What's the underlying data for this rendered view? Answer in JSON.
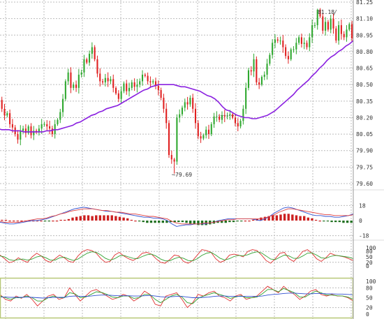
{
  "colors": {
    "background": "#ffffff",
    "grid": "#bcbcbc",
    "up": "#2fa82f",
    "down": "#e02020",
    "ma": "#8a20e0",
    "macd_signal_red": "#e04040",
    "macd_line_blue": "#3050d0",
    "hist_pos": "#cc2020",
    "hist_neg": "#207020",
    "stoch_red": "#e03030",
    "stoch_green": "#30a030",
    "stoch_blue": "#3050d0",
    "panel_frame": "#b8c878"
  },
  "chart_data": [
    {
      "type": "candlestick",
      "title": "",
      "y_ticks": [
        "81.25",
        "81.10",
        "80.95",
        "80.80",
        "80.65",
        "80.50",
        "80.35",
        "80.20",
        "80.05",
        "79.90",
        "79.75",
        "79.60"
      ],
      "ylim": [
        79.6,
        81.25
      ],
      "grid": true,
      "annotations": [
        {
          "text": "79.69",
          "value": 79.69
        },
        {
          "text": "81.18",
          "value": 81.18
        }
      ],
      "series": [
        {
          "kind": "candles",
          "close": [
            80.36,
            80.28,
            80.22,
            80.24,
            80.14,
            80.11,
            80.05,
            80.0,
            80.08,
            80.1,
            80.06,
            80.12,
            80.04,
            80.08,
            80.07,
            80.1,
            80.14,
            80.14,
            80.12,
            80.1,
            80.05,
            80.14,
            80.18,
            80.25,
            80.37,
            80.53,
            80.61,
            80.47,
            80.5,
            80.47,
            80.59,
            80.61,
            80.73,
            80.7,
            80.78,
            80.84,
            80.73,
            80.6,
            80.53,
            80.52,
            80.56,
            80.53,
            80.55,
            80.47,
            80.42,
            80.37,
            80.44,
            80.51,
            80.44,
            80.47,
            80.52,
            80.48,
            80.5,
            80.53,
            80.59,
            80.58,
            80.53,
            80.52,
            80.53,
            80.49,
            80.45,
            80.38,
            80.28,
            80.15,
            79.86,
            79.82,
            79.8,
            80.2,
            80.23,
            80.29,
            80.34,
            80.32,
            80.38,
            80.28,
            80.15,
            80.03,
            80.01,
            80.04,
            80.09,
            80.05,
            80.14,
            80.21,
            80.21,
            80.18,
            80.22,
            80.21,
            80.22,
            80.23,
            80.2,
            80.15,
            80.12,
            80.17,
            80.28,
            80.47,
            80.63,
            80.62,
            80.73,
            80.52,
            80.5,
            80.57,
            80.59,
            80.69,
            80.77,
            80.88,
            80.91,
            80.9,
            80.9,
            80.84,
            80.76,
            80.73,
            80.82,
            80.82,
            80.88,
            80.93,
            80.87,
            80.88,
            80.84,
            80.93,
            81.04,
            81.04,
            81.18,
            81.12,
            80.99,
            81.07,
            81.0,
            81.1,
            81.01,
            80.9,
            81.04,
            80.96,
            80.93,
            81.0,
            81.05,
            80.92
          ],
          "color": "#2fa82f"
        },
        {
          "kind": "ma",
          "values": [
            80.1,
            80.09,
            80.09,
            80.09,
            80.08,
            80.08,
            80.08,
            80.07,
            80.07,
            80.07,
            80.07,
            80.07,
            80.07,
            80.08,
            80.08,
            80.09,
            80.09,
            80.1,
            80.11,
            80.12,
            80.13,
            80.15,
            80.16,
            80.18,
            80.2,
            80.22,
            80.23,
            80.25,
            80.26,
            80.28,
            80.29,
            80.3,
            80.31,
            80.33,
            80.35,
            80.37,
            80.39,
            80.41,
            80.43,
            80.45,
            80.46,
            80.48,
            80.49,
            80.5,
            80.5,
            80.5,
            80.5,
            80.5,
            80.49,
            80.48,
            80.48,
            80.47,
            80.46,
            80.45,
            80.44,
            80.42,
            80.4,
            80.39,
            80.37,
            80.34,
            80.3,
            80.27,
            80.26,
            80.24,
            80.22,
            80.21,
            80.2,
            80.2,
            80.19,
            80.19,
            80.2,
            80.21,
            80.22,
            80.24,
            80.26,
            80.29,
            80.32,
            80.35,
            80.38,
            80.41,
            80.45,
            80.48,
            80.51,
            80.54,
            80.58,
            80.61,
            80.65,
            80.68,
            80.72,
            80.75,
            80.77,
            80.8,
            80.82,
            80.85,
            80.87,
            80.9
          ],
          "color": "#8a20e0"
        }
      ]
    },
    {
      "type": "bar",
      "name": "macd",
      "y_ticks": [
        "18",
        "0",
        "-18"
      ],
      "ylim": [
        -25,
        25
      ],
      "histogram": [
        1,
        1,
        0,
        0,
        0,
        0,
        0,
        0,
        0,
        0,
        0,
        -1,
        -1,
        0,
        0,
        1,
        1,
        2,
        4,
        5,
        6,
        7,
        7,
        6,
        7,
        7,
        7,
        7,
        7,
        6,
        5,
        4,
        3,
        1,
        0,
        -1,
        -2,
        -3,
        -3,
        -3,
        -3,
        -3,
        -3,
        -2,
        -2,
        -2,
        -2,
        -3,
        -4,
        -5,
        -6,
        -6,
        -6,
        -5,
        -4,
        -3,
        -3,
        -3,
        -2,
        -2,
        -1,
        -1,
        0,
        0,
        1,
        2,
        4,
        5,
        6,
        7,
        7,
        8,
        9,
        9,
        8,
        7,
        6,
        6,
        4,
        3,
        1,
        0,
        -1,
        -1,
        -2,
        -2,
        -2,
        -3,
        -3,
        -3
      ],
      "line_a": [
        -2,
        -3,
        -4,
        -4,
        -3,
        -2,
        -1,
        0,
        0,
        1,
        2,
        4,
        6,
        8,
        10,
        12,
        14,
        15,
        16,
        15,
        14,
        13,
        12,
        11,
        11,
        10,
        9,
        8,
        7,
        6,
        5,
        4,
        4,
        3,
        3,
        2,
        0,
        -4,
        -7,
        -6,
        -5,
        -5,
        -4,
        -4,
        -4,
        -3,
        -2,
        0,
        1,
        2,
        2,
        2,
        2,
        2,
        2,
        1,
        0,
        2,
        5,
        9,
        12,
        15,
        16,
        15,
        13,
        11,
        9,
        7,
        6,
        6,
        5,
        5,
        4,
        4,
        5,
        6,
        8
      ],
      "line_b": [
        -1,
        -2,
        -2,
        -2,
        -2,
        -1,
        0,
        1,
        2,
        2,
        3,
        5,
        6,
        8,
        9,
        11,
        12,
        13,
        14,
        14,
        14,
        13,
        12,
        12,
        11,
        10,
        10,
        9,
        8,
        8,
        7,
        6,
        5,
        5,
        4,
        3,
        2,
        -1,
        -3,
        -4,
        -4,
        -4,
        -4,
        -4,
        -3,
        -3,
        -2,
        -1,
        0,
        1,
        1,
        2,
        2,
        2,
        2,
        2,
        2,
        3,
        5,
        7,
        10,
        12,
        14,
        14,
        13,
        12,
        11,
        10,
        9,
        8,
        7,
        7,
        6,
        6,
        6,
        6,
        7
      ]
    },
    {
      "type": "line",
      "name": "oscillator-1",
      "y_ticks": [
        "100",
        "80",
        "50",
        "20",
        "0"
      ],
      "ylim": [
        0,
        100
      ],
      "series": [
        {
          "values": [
            60,
            40,
            18,
            25,
            45,
            30,
            20,
            50,
            70,
            55,
            30,
            20,
            40,
            60,
            45,
            25,
            20,
            55,
            80,
            90,
            85,
            70,
            40,
            20,
            25,
            60,
            75,
            55,
            40,
            30,
            45,
            70,
            75,
            65,
            40,
            20,
            15,
            35,
            60,
            55,
            25,
            15,
            30,
            60,
            90,
            85,
            75,
            40,
            20,
            30,
            60,
            65,
            60,
            50,
            80,
            90,
            85,
            60,
            30,
            15,
            40,
            70,
            75,
            40,
            25,
            50,
            80,
            90,
            70,
            40,
            25,
            45,
            70,
            60,
            55,
            50,
            40,
            30
          ],
          "color": "#e03030"
        },
        {
          "values": [
            55,
            50,
            35,
            30,
            35,
            38,
            32,
            38,
            50,
            55,
            45,
            32,
            32,
            45,
            48,
            38,
            30,
            38,
            55,
            70,
            78,
            75,
            60,
            42,
            32,
            40,
            55,
            58,
            50,
            42,
            40,
            52,
            62,
            65,
            55,
            38,
            28,
            28,
            40,
            48,
            42,
            30,
            28,
            40,
            58,
            70,
            75,
            60,
            42,
            33,
            40,
            52,
            58,
            56,
            62,
            72,
            78,
            72,
            55,
            38,
            35,
            48,
            60,
            55,
            42,
            42,
            55,
            70,
            72,
            60,
            45,
            42,
            52,
            58,
            56,
            52,
            48,
            40
          ],
          "color": "#30a030"
        }
      ]
    },
    {
      "type": "line",
      "name": "oscillator-2",
      "y_ticks": [
        "100",
        "80",
        "50",
        "20",
        "0"
      ],
      "ylim": [
        0,
        100
      ],
      "series": [
        {
          "values": [
            60,
            45,
            40,
            55,
            48,
            60,
            45,
            25,
            40,
            55,
            60,
            45,
            50,
            80,
            60,
            40,
            55,
            70,
            75,
            65,
            55,
            45,
            50,
            60,
            55,
            40,
            50,
            70,
            60,
            30,
            25,
            55,
            60,
            65,
            45,
            20,
            35,
            60,
            55,
            65,
            70,
            55,
            50,
            40,
            55,
            60,
            45,
            50,
            55,
            70,
            85,
            75,
            65,
            85,
            70,
            60,
            45,
            55,
            70,
            75,
            60,
            55,
            60,
            55,
            55,
            50,
            40
          ],
          "color": "#e03030"
        },
        {
          "values": [
            55,
            50,
            45,
            50,
            50,
            55,
            50,
            40,
            40,
            50,
            55,
            50,
            50,
            65,
            62,
            50,
            52,
            60,
            68,
            66,
            60,
            52,
            50,
            55,
            55,
            48,
            50,
            60,
            60,
            45,
            35,
            45,
            55,
            60,
            52,
            35,
            32,
            48,
            55,
            60,
            65,
            60,
            55,
            48,
            52,
            56,
            50,
            50,
            52,
            62,
            75,
            75,
            68,
            78,
            72,
            65,
            52,
            52,
            62,
            70,
            65,
            58,
            58,
            56,
            55,
            52,
            45
          ],
          "color": "#30a030"
        },
        {
          "values": [
            52,
            52,
            51,
            51,
            51,
            52,
            51,
            50,
            49,
            50,
            51,
            51,
            51,
            54,
            55,
            54,
            54,
            55,
            57,
            58,
            58,
            57,
            56,
            56,
            56,
            55,
            55,
            56,
            57,
            55,
            53,
            52,
            53,
            54,
            54,
            52,
            50,
            50,
            51,
            52,
            54,
            55,
            55,
            54,
            54,
            54,
            54,
            54,
            54,
            55,
            58,
            60,
            61,
            63,
            64,
            64,
            63,
            62,
            62,
            63,
            63,
            62,
            62,
            61,
            61,
            60,
            59
          ],
          "color": "#3050d0"
        }
      ]
    }
  ]
}
